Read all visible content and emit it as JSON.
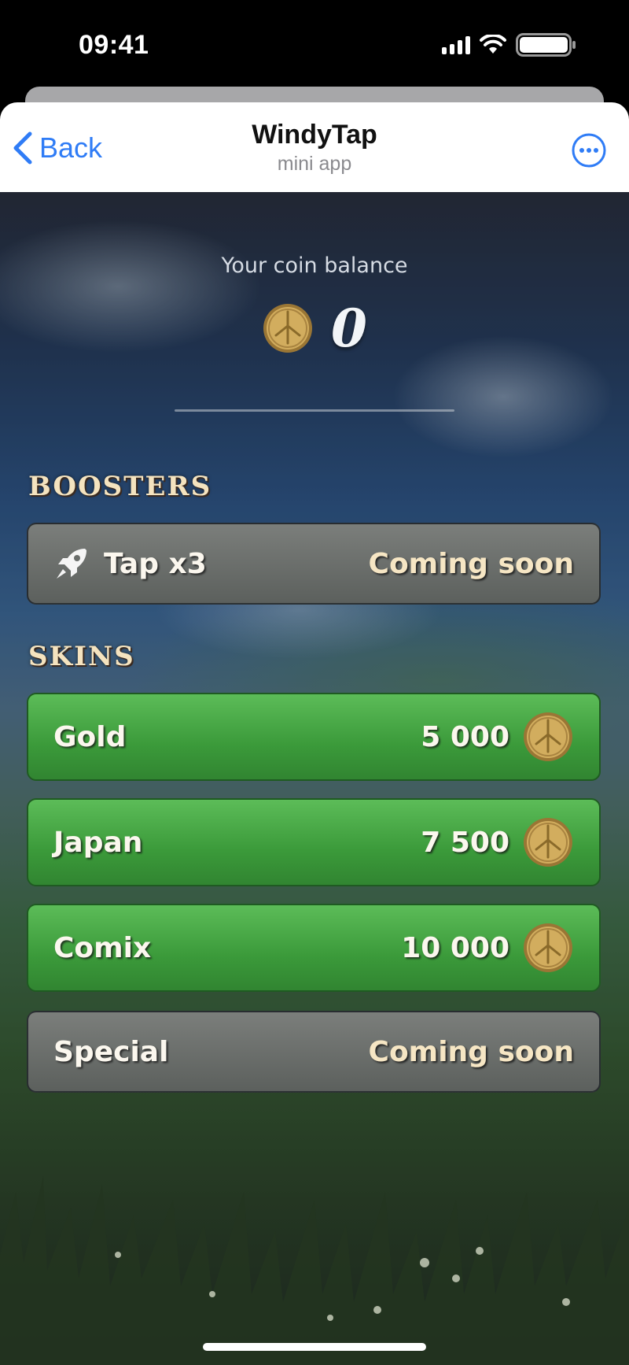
{
  "status_bar": {
    "time": "09:41"
  },
  "header": {
    "back_label": "Back",
    "title": "WindyTap",
    "subtitle": "mini app"
  },
  "balance": {
    "label": "Your coin balance",
    "value": "0"
  },
  "boosters": {
    "title": "BOOSTERS",
    "items": [
      {
        "label": "Tap x3",
        "icon": "rocket-icon",
        "status": "Coming soon"
      }
    ]
  },
  "skins": {
    "title": "SKINS",
    "items": [
      {
        "label": "Gold",
        "price": "5 000"
      },
      {
        "label": "Japan",
        "price": "7 500"
      },
      {
        "label": "Comix",
        "price": "10 000"
      },
      {
        "label": "Special",
        "status": "Coming soon"
      }
    ]
  },
  "colors": {
    "accent": "#2f7cf6",
    "green": "#3b9a3a",
    "gray": "#5c605d",
    "gold": "#c9a24f"
  }
}
